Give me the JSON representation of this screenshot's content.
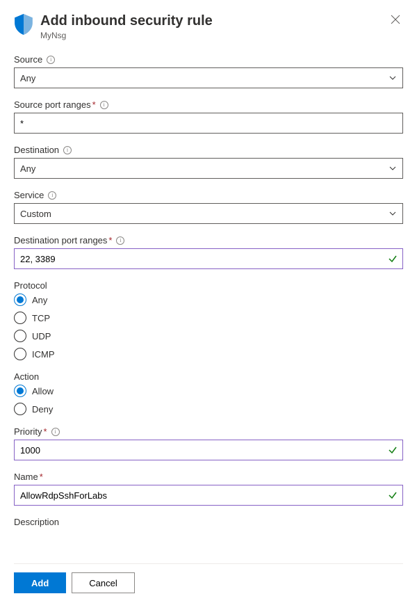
{
  "header": {
    "title": "Add inbound security rule",
    "subtitle": "MyNsg"
  },
  "fields": {
    "source": {
      "label": "Source",
      "value": "Any"
    },
    "source_port_ranges": {
      "label": "Source port ranges",
      "value": "*"
    },
    "destination": {
      "label": "Destination",
      "value": "Any"
    },
    "service": {
      "label": "Service",
      "value": "Custom"
    },
    "dest_port_ranges": {
      "label": "Destination port ranges",
      "value": "22, 3389"
    },
    "protocol": {
      "label": "Protocol",
      "options": [
        "Any",
        "TCP",
        "UDP",
        "ICMP"
      ],
      "selected": "Any"
    },
    "action": {
      "label": "Action",
      "options": [
        "Allow",
        "Deny"
      ],
      "selected": "Allow"
    },
    "priority": {
      "label": "Priority",
      "value": "1000"
    },
    "name": {
      "label": "Name",
      "value": "AllowRdpSshForLabs"
    },
    "description": {
      "label": "Description"
    }
  },
  "footer": {
    "primary": "Add",
    "secondary": "Cancel"
  },
  "required_marker": "*"
}
